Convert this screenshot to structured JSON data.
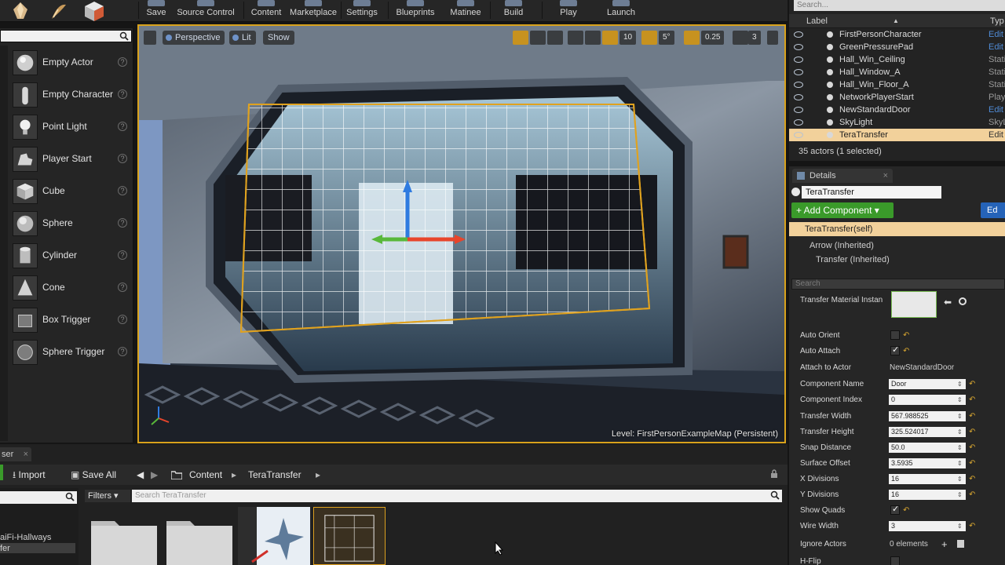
{
  "toolbar": {
    "buttons": [
      "Save",
      "Source Control",
      "Content",
      "Marketplace",
      "Settings",
      "Blueprints",
      "Matinee",
      "Build",
      "Play",
      "Launch"
    ]
  },
  "palette": {
    "items": [
      "Empty Actor",
      "Empty Character",
      "Point Light",
      "Player Start",
      "Cube",
      "Sphere",
      "Cylinder",
      "Cone",
      "Box Trigger",
      "Sphere Trigger"
    ],
    "help_glyph": "?"
  },
  "viewport": {
    "perspective": "Perspective",
    "lit": "Lit",
    "show": "Show",
    "grid_size": "10",
    "rotation_snap": "5°",
    "scale_snap": "0.25",
    "camera_speed": "3",
    "level_label": "Level:  FirstPersonExampleMap (Persistent)"
  },
  "outliner": {
    "search_placeholder": "Search...",
    "col_label": "Label",
    "col_type": "Typ",
    "sort_glyph": "▲",
    "rows": [
      {
        "name": "FirstPersonCharacter",
        "type": "Edit",
        "link": true
      },
      {
        "name": "GreenPressurePad",
        "type": "Edit",
        "link": true
      },
      {
        "name": "Hall_Win_Ceiling",
        "type": "Stati",
        "link": false
      },
      {
        "name": "Hall_Window_A",
        "type": "Stati",
        "link": false
      },
      {
        "name": "Hall_Win_Floor_A",
        "type": "Stati",
        "link": false
      },
      {
        "name": "NetworkPlayerStart",
        "type": "Playe",
        "link": false
      },
      {
        "name": "NewStandardDoor",
        "type": "Edit",
        "link": true
      },
      {
        "name": "SkyLight",
        "type": "SkyL",
        "link": false
      },
      {
        "name": "TeraTransfer",
        "type": "Edit",
        "link": false,
        "selected": true
      }
    ],
    "count": "35 actors (1 selected)"
  },
  "details": {
    "tab": "Details",
    "tab_close": "×",
    "name": "TeraTransfer",
    "add_component": "+ Add Component ▾",
    "edit_blueprint": "Ed",
    "components": [
      "TeraTransfer(self)",
      "Arrow (Inherited)",
      "Transfer (Inherited)"
    ],
    "search_placeholder": "Search",
    "props": [
      {
        "label": "Transfer Material Instan",
        "kind": "thumb"
      },
      {
        "label": "Auto Orient",
        "kind": "check",
        "value": false
      },
      {
        "label": "Auto Attach",
        "kind": "check",
        "value": true
      },
      {
        "label": "Attach to Actor",
        "kind": "text",
        "value": "NewStandardDoor"
      },
      {
        "label": "Component Name",
        "kind": "field",
        "value": "Door"
      },
      {
        "label": "Component Index",
        "kind": "field",
        "value": "0"
      },
      {
        "label": "Transfer Width",
        "kind": "field",
        "value": "567.988525"
      },
      {
        "label": "Transfer Height",
        "kind": "field",
        "value": "325.524017"
      },
      {
        "label": "Snap Distance",
        "kind": "field",
        "value": "50.0"
      },
      {
        "label": "Surface Offset",
        "kind": "field",
        "value": "3.5935"
      },
      {
        "label": "X Divisions",
        "kind": "field",
        "value": "16"
      },
      {
        "label": "Y Divisions",
        "kind": "field",
        "value": "16"
      },
      {
        "label": "Show Quads",
        "kind": "check",
        "value": true
      },
      {
        "label": "Wire Width",
        "kind": "field",
        "value": "3"
      },
      {
        "label": "Ignore Actors",
        "kind": "text",
        "value": "0 elements"
      },
      {
        "label": "H-Flip",
        "kind": "check",
        "value": false
      }
    ]
  },
  "content_browser": {
    "tab": "ser",
    "tab_close": "×",
    "import": "Import",
    "save_all": "Save All",
    "path": [
      "Content",
      "TeraTransfer"
    ],
    "filters": "Filters ▾",
    "search_placeholder": "Search TeraTransfer",
    "tree": [
      "aiFi-Hallways",
      "fer"
    ]
  }
}
